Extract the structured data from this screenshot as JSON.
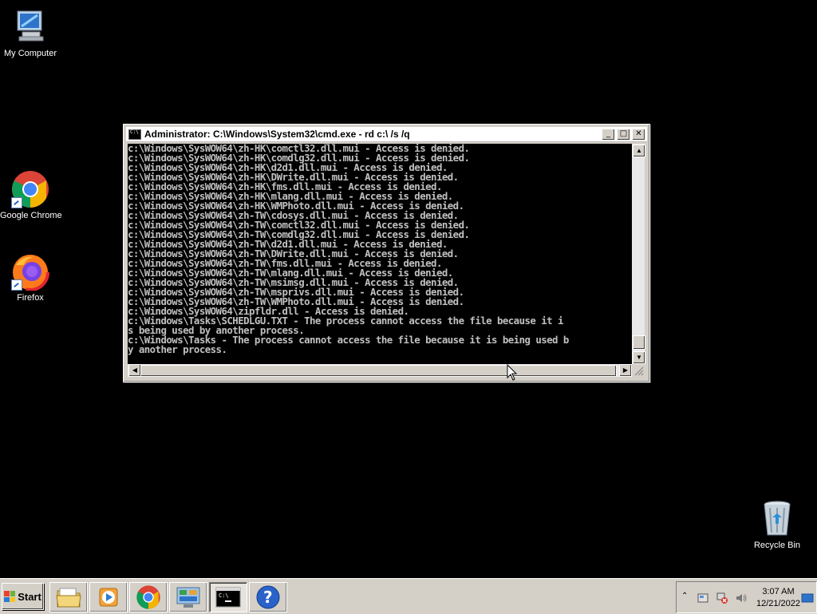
{
  "desktop": {
    "icons": [
      {
        "label": "My Computer"
      },
      {
        "label": "Google Chrome"
      },
      {
        "label": "Firefox"
      },
      {
        "label": "Recycle Bin"
      }
    ]
  },
  "window": {
    "title": "Administrator: C:\\Windows\\System32\\cmd.exe - rd  c:\\ /s /q",
    "console_lines": [
      "c:\\Windows\\SysWOW64\\zh-HK\\comctl32.dll.mui - Access is denied.",
      "c:\\Windows\\SysWOW64\\zh-HK\\comdlg32.dll.mui - Access is denied.",
      "c:\\Windows\\SysWOW64\\zh-HK\\d2d1.dll.mui - Access is denied.",
      "c:\\Windows\\SysWOW64\\zh-HK\\DWrite.dll.mui - Access is denied.",
      "c:\\Windows\\SysWOW64\\zh-HK\\fms.dll.mui - Access is denied.",
      "c:\\Windows\\SysWOW64\\zh-HK\\mlang.dll.mui - Access is denied.",
      "c:\\Windows\\SysWOW64\\zh-HK\\WMPhoto.dll.mui - Access is denied.",
      "c:\\Windows\\SysWOW64\\zh-TW\\cdosys.dll.mui - Access is denied.",
      "c:\\Windows\\SysWOW64\\zh-TW\\comctl32.dll.mui - Access is denied.",
      "c:\\Windows\\SysWOW64\\zh-TW\\comdlg32.dll.mui - Access is denied.",
      "c:\\Windows\\SysWOW64\\zh-TW\\d2d1.dll.mui - Access is denied.",
      "c:\\Windows\\SysWOW64\\zh-TW\\DWrite.dll.mui - Access is denied.",
      "c:\\Windows\\SysWOW64\\zh-TW\\fms.dll.mui - Access is denied.",
      "c:\\Windows\\SysWOW64\\zh-TW\\mlang.dll.mui - Access is denied.",
      "c:\\Windows\\SysWOW64\\zh-TW\\msimsg.dll.mui - Access is denied.",
      "c:\\Windows\\SysWOW64\\zh-TW\\msprivs.dll.mui - Access is denied.",
      "c:\\Windows\\SysWOW64\\zh-TW\\WMPhoto.dll.mui - Access is denied.",
      "c:\\Windows\\SysWOW64\\zipfldr.dll - Access is denied.",
      "c:\\Windows\\Tasks\\SCHEDLGU.TXT - The process cannot access the file because it i",
      "s being used by another process.",
      "c:\\Windows\\Tasks - The process cannot access the file because it is being used b",
      "y another process."
    ],
    "buttons": {
      "minimize": "_",
      "maximize": "□",
      "close": "✕"
    }
  },
  "taskbar": {
    "start_label": "Start",
    "apps": [
      {
        "name": "Windows Explorer",
        "icon": "folder-icon"
      },
      {
        "name": "Windows Media Player",
        "icon": "media-player-icon"
      },
      {
        "name": "Google Chrome",
        "icon": "chrome-icon"
      },
      {
        "name": "Control Panel",
        "icon": "control-panel-icon"
      },
      {
        "name": "Command Prompt",
        "icon": "cmd-icon",
        "active": true
      },
      {
        "name": "Help",
        "icon": "help-icon"
      }
    ],
    "tray": {
      "time": "3:07 AM",
      "date": "12/21/2022"
    }
  }
}
